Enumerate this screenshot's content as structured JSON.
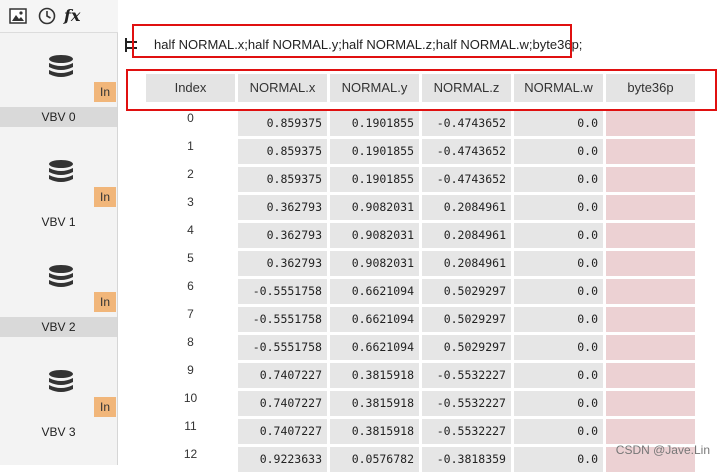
{
  "toolbar": {
    "icons": [
      "image-icon",
      "history-icon",
      "fx-icon"
    ],
    "fx_label": "fx"
  },
  "sidebar": {
    "items": [
      {
        "label": "VBV 0",
        "badge": "In",
        "selected": false
      },
      {
        "label": "VBV 1",
        "badge": "In",
        "selected": false
      },
      {
        "label": "VBV 2",
        "badge": "In",
        "selected": true
      },
      {
        "label": "VBV 3",
        "badge": "In",
        "selected": false
      }
    ]
  },
  "format": {
    "text": "half NORMAL.x;half NORMAL.y;half NORMAL.z;half NORMAL.w;byte36p;"
  },
  "table": {
    "columns": [
      "Index",
      "NORMAL.x",
      "NORMAL.y",
      "NORMAL.z",
      "NORMAL.w",
      "byte36p"
    ],
    "rows": [
      {
        "index": "0",
        "x": "0.859375",
        "y": "0.1901855",
        "z": "-0.4743652",
        "w": "0.0"
      },
      {
        "index": "1",
        "x": "0.859375",
        "y": "0.1901855",
        "z": "-0.4743652",
        "w": "0.0"
      },
      {
        "index": "2",
        "x": "0.859375",
        "y": "0.1901855",
        "z": "-0.4743652",
        "w": "0.0"
      },
      {
        "index": "3",
        "x": "0.362793",
        "y": "0.9082031",
        "z": "0.2084961",
        "w": "0.0"
      },
      {
        "index": "4",
        "x": "0.362793",
        "y": "0.9082031",
        "z": "0.2084961",
        "w": "0.0"
      },
      {
        "index": "5",
        "x": "0.362793",
        "y": "0.9082031",
        "z": "0.2084961",
        "w": "0.0"
      },
      {
        "index": "6",
        "x": "-0.5551758",
        "y": "0.6621094",
        "z": "0.5029297",
        "w": "0.0"
      },
      {
        "index": "7",
        "x": "-0.5551758",
        "y": "0.6621094",
        "z": "0.5029297",
        "w": "0.0"
      },
      {
        "index": "8",
        "x": "-0.5551758",
        "y": "0.6621094",
        "z": "0.5029297",
        "w": "0.0"
      },
      {
        "index": "9",
        "x": "0.7407227",
        "y": "0.3815918",
        "z": "-0.5532227",
        "w": "0.0"
      },
      {
        "index": "10",
        "x": "0.7407227",
        "y": "0.3815918",
        "z": "-0.5532227",
        "w": "0.0"
      },
      {
        "index": "11",
        "x": "0.7407227",
        "y": "0.3815918",
        "z": "-0.5532227",
        "w": "0.0"
      },
      {
        "index": "12",
        "x": "0.9223633",
        "y": "0.0576782",
        "z": "-0.3818359",
        "w": "0.0"
      }
    ]
  },
  "watermark": "CSDN @Jave.Lin",
  "colors": {
    "highlight_border": "#e01010",
    "badge": "#f1b67a",
    "byte_cell": "#ecd1d3"
  }
}
